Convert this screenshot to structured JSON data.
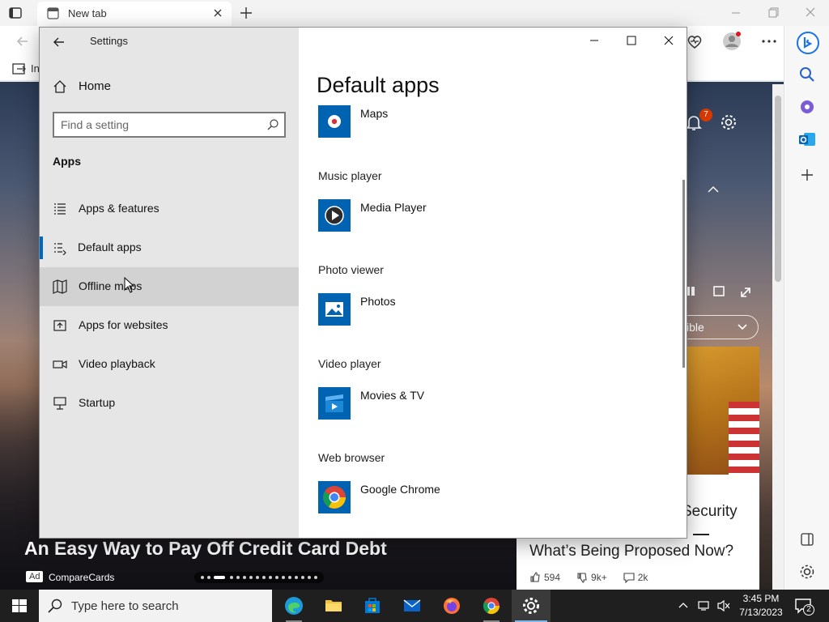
{
  "browser": {
    "tab_title": "New tab",
    "bookmark_partial": "In",
    "notification_count": "7"
  },
  "msn": {
    "hero_caption": "An Easy Way to Pay Off Credit Card Debt",
    "ad_badge": "Ad",
    "ad_source": "CompareCards",
    "right_headline_top": "Security",
    "right_headline": "What’s Being Proposed Now?",
    "likes": "594",
    "dislikes": "9k+",
    "comments": "2k",
    "pill_partial": "ible"
  },
  "settings": {
    "window_title": "Settings",
    "home_label": "Home",
    "search_placeholder": "Find a setting",
    "section_title": "Apps",
    "nav_items": [
      {
        "label": "Apps & features",
        "icon": "list-icon"
      },
      {
        "label": "Default apps",
        "icon": "default-apps-icon"
      },
      {
        "label": "Offline maps",
        "icon": "map-icon"
      },
      {
        "label": "Apps for websites",
        "icon": "open-link-icon"
      },
      {
        "label": "Video playback",
        "icon": "video-icon"
      },
      {
        "label": "Startup",
        "icon": "startup-icon"
      }
    ],
    "selected_item": "Default apps",
    "page_title": "Default apps",
    "defaults": [
      {
        "category": "",
        "app": "Maps",
        "color": "#0063b1"
      },
      {
        "category": "Music player",
        "app": "Media Player",
        "color": "#0063b1"
      },
      {
        "category": "Photo viewer",
        "app": "Photos",
        "color": "#0063b1"
      },
      {
        "category": "Video player",
        "app": "Movies & TV",
        "color": "#0063b1"
      },
      {
        "category": "Web browser",
        "app": "Google Chrome",
        "color": "#0063b1"
      }
    ]
  },
  "taskbar": {
    "search_placeholder": "Type here to search",
    "time": "3:45 PM",
    "date": "7/13/2023",
    "notifications": "2"
  },
  "colors": {
    "accent": "#0067c0",
    "tile_blue": "#0063b1",
    "taskbar": "#1f1f1f"
  }
}
